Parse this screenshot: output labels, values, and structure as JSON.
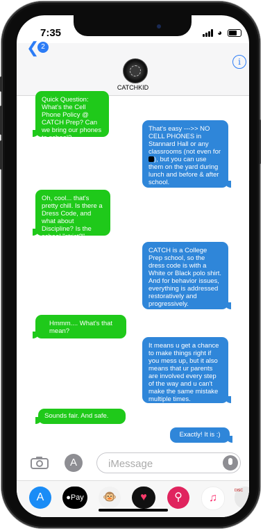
{
  "status": {
    "time": "7:35"
  },
  "header": {
    "back_badge": "2",
    "contact_name": "CATCHKID",
    "info_label": "i"
  },
  "messages": [
    {
      "side": "sent",
      "text": "Quick Question:  What's the Cell Phone Policy @ CATCH Prep?  Can we bring our phones to school?"
    },
    {
      "side": "received",
      "text_a": "That's easy --->> NO CELL PHONES in Stannard Hall or any classrooms (not even for ",
      "text_b": "), but you can use them on the yard during lunch and before & after school."
    },
    {
      "side": "sent",
      "text": "Oh, cool... that's pretty chill. Is there a Dress Code, and what about Discipline? Is the school \"strict?\""
    },
    {
      "side": "received",
      "text": "CATCH is a College Prep school, so the dress code is  with a White or Black polo shirt. And for behavior issues, everything is addressed restoratively and progressively."
    },
    {
      "side": "sent",
      "text": "Hmmm.... What's that mean?"
    },
    {
      "side": "received",
      "text": "It means u get a chance to make things right if you mess up, but it also means that ur parents are involved every step of the way and u can't make the same mistake multiple times."
    },
    {
      "side": "sent",
      "text": "Sounds fair. And safe."
    },
    {
      "side": "received",
      "text": "Exactly! It is :)"
    }
  ],
  "composer": {
    "placeholder": "iMessage"
  },
  "app_drawer": {
    "items": [
      "app-store",
      "Pay",
      "monkey",
      "heart",
      "search",
      "music",
      "DISC"
    ]
  },
  "colors": {
    "sent_bubble": "#1fc91a",
    "received_bubble": "#2f86d9",
    "accent": "#2c7cf6"
  }
}
